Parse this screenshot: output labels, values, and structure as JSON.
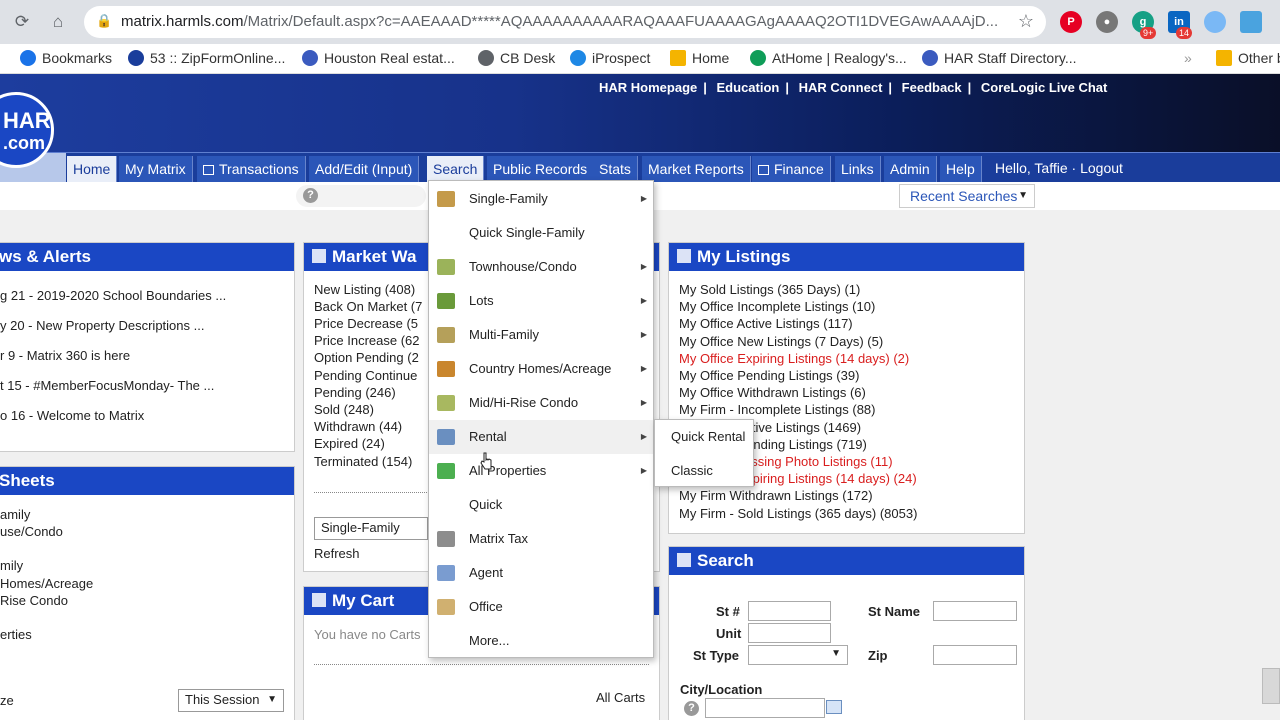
{
  "browser": {
    "url_host": "matrix.harmls.com",
    "url_path": "/Matrix/Default.aspx?c=AAEAAAD*****AQAAAAAAAAAARAQAAAFUAAAAGAgAAAAQ2OTI1DVEGAwAAAAjD...",
    "ext_badges": [
      "9+",
      "14"
    ],
    "bookmarks": [
      {
        "label": "Bookmarks",
        "color": "#1a73e8"
      },
      {
        "label": "53 :: ZipFormOnline...",
        "color": "#1a3d9b"
      },
      {
        "label": "Houston Real estat...",
        "color": "#3b5bbf"
      },
      {
        "label": "CB Desk",
        "color": "#5f6368"
      },
      {
        "label": "iProspect",
        "color": "#1e88e5"
      },
      {
        "label": "Home",
        "color": "#f4b400"
      },
      {
        "label": "AtHome | Realogy's...",
        "color": "#0f9d58"
      },
      {
        "label": "HAR Staff Directory...",
        "color": "#3b5bbf"
      },
      {
        "label": "Other b",
        "color": "#f4b400"
      }
    ]
  },
  "header": {
    "logo_l1": "HAR",
    "logo_l2": ".com",
    "top_links": [
      "HAR Homepage",
      "Education",
      "HAR Connect",
      "Feedback",
      "CoreLogic Live Chat"
    ]
  },
  "nav": {
    "tabs": [
      "Home",
      "My Matrix",
      "Transactions",
      "Add/Edit (Input)",
      "Search",
      "Public Records",
      "Stats",
      "Market Reports",
      "Finance",
      "Links",
      "Admin",
      "Help"
    ],
    "hello": "Hello, Taffie · Logout",
    "recent_searches": "Recent Searches"
  },
  "news": {
    "title": "ws & Alerts",
    "items": [
      "g 21 - 2019-2020 School Boundaries ...",
      "y 20 - New Property Descriptions ...",
      "r 9 - Matrix 360 is here",
      "t 15 - #MemberFocusMonday- The ...",
      "o 16 - Welcome to Matrix"
    ]
  },
  "sheets": {
    "title": "Sheets",
    "items": [
      "amily",
      "use/Condo",
      "",
      "mily",
      "Homes/Acreage",
      "Rise Condo",
      "",
      "erties"
    ],
    "footer_label": "ze",
    "session_select": "This Session"
  },
  "market": {
    "title": "Market Wa",
    "items": [
      "New Listing (408)",
      "Back On Market (7",
      "Price Decrease (5",
      "Price Increase (62",
      "Option Pending (2",
      "Pending Continue",
      "Pending (246)",
      "Sold (248)",
      "Withdrawn (44)",
      "Expired (24)",
      "Terminated (154)"
    ],
    "select_value": "Single-Family",
    "refresh": "Refresh"
  },
  "cart": {
    "title": "My Cart",
    "empty_text": "You have no Carts",
    "all_carts": "All Carts"
  },
  "listings": {
    "title": "My Listings",
    "items": [
      {
        "text": "My Sold Listings (365 Days) (1)",
        "red": false
      },
      {
        "text": "My Office Incomplete Listings (10)",
        "red": false
      },
      {
        "text": "My Office Active Listings (117)",
        "red": false
      },
      {
        "text": "My Office New Listings (7 Days) (5)",
        "red": false
      },
      {
        "text": "My Office Expiring Listings (14 days) (2)",
        "red": true
      },
      {
        "text": "My Office Pending Listings (39)",
        "red": false
      },
      {
        "text": "My Office Withdrawn Listings (6)",
        "red": false
      },
      {
        "text": "My Firm - Incomplete Listings (88)",
        "red": false
      },
      {
        "text": "My Firm - Active Listings (1469)",
        "red": false
      },
      {
        "text": "My Firm - Pending Listings (719)",
        "red": false
      },
      {
        "text": "My Firm - Missing Photo Listings (11)",
        "red": true
      },
      {
        "text": "My Firm - Expiring Listings (14 days) (24)",
        "red": true
      },
      {
        "text": "My Firm Withdrawn Listings (172)",
        "red": false
      },
      {
        "text": "My Firm - Sold Listings (365 days) (8053)",
        "red": false
      }
    ]
  },
  "search_panel": {
    "title": "Search",
    "st_num": "St #",
    "st_name": "St Name",
    "unit": "Unit",
    "st_type": "St Type",
    "zip": "Zip",
    "city": "City/Location"
  },
  "dropdown": {
    "items": [
      {
        "label": "Single-Family",
        "arrow": true,
        "icon": "house-icon",
        "color": "#c49a4a"
      },
      {
        "label": "Quick Single-Family",
        "arrow": false,
        "icon": "",
        "color": ""
      },
      {
        "label": "Townhouse/Condo",
        "arrow": true,
        "icon": "building-icon",
        "color": "#9bb35a"
      },
      {
        "label": "Lots",
        "arrow": true,
        "icon": "tree-icon",
        "color": "#6a9a3a"
      },
      {
        "label": "Multi-Family",
        "arrow": true,
        "icon": "apartments-icon",
        "color": "#b5a05a"
      },
      {
        "label": "Country Homes/Acreage",
        "arrow": true,
        "icon": "tractor-icon",
        "color": "#c9862e"
      },
      {
        "label": "Mid/Hi-Rise Condo",
        "arrow": true,
        "icon": "tower-icon",
        "color": "#a8b860"
      },
      {
        "label": "Rental",
        "arrow": true,
        "icon": "rental-icon",
        "color": "#6a8fc0"
      },
      {
        "label": "All Properties",
        "arrow": true,
        "icon": "all-properties-icon",
        "color": "#4caf50"
      },
      {
        "label": "Quick",
        "arrow": false,
        "icon": "",
        "color": ""
      },
      {
        "label": "Matrix Tax",
        "arrow": false,
        "icon": "bank-icon",
        "color": "#8d8d8d"
      },
      {
        "label": "Agent",
        "arrow": false,
        "icon": "agent-icon",
        "color": "#7a9cd0"
      },
      {
        "label": "Office",
        "arrow": false,
        "icon": "office-icon",
        "color": "#d0b070"
      },
      {
        "label": "More...",
        "arrow": false,
        "icon": "",
        "color": ""
      }
    ],
    "rental_submenu": [
      "Quick Rental",
      "Classic"
    ]
  }
}
